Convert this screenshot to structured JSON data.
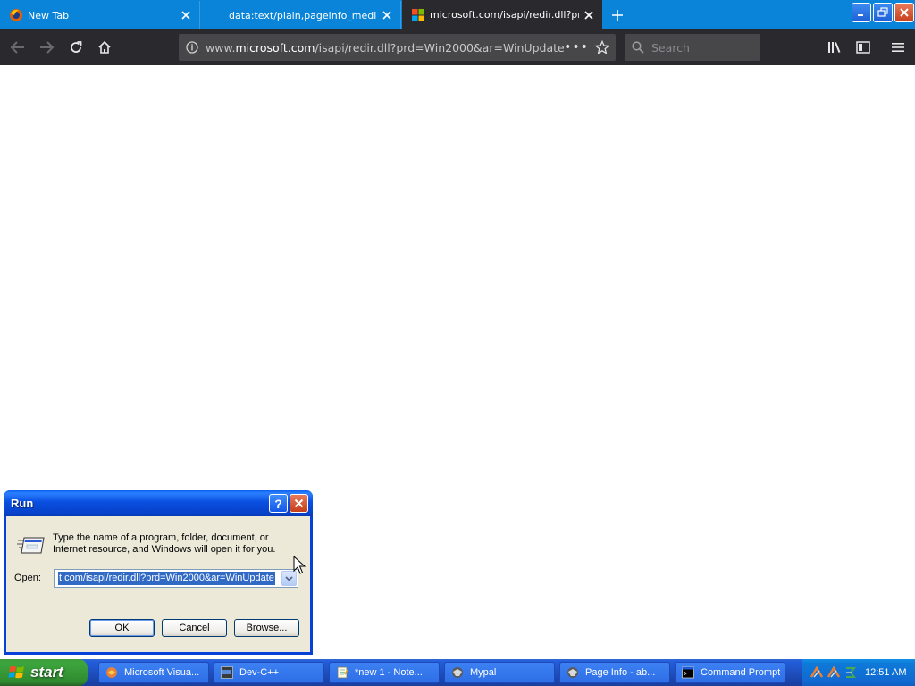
{
  "browser": {
    "tabs": [
      {
        "title": "New Tab",
        "favicon": "firefox-icon",
        "active": false
      },
      {
        "title": "data:text/plain,pageinfo_media",
        "favicon": "none",
        "active": false
      },
      {
        "title": "microsoft.com/isapi/redir.dll?prd=W",
        "favicon": "microsoft-logo-icon",
        "active": true
      }
    ],
    "url": {
      "prefix": "www.",
      "domain": "microsoft.com",
      "path": "/isapi/redir.dll?prd=Win2000&ar=WinUpdate"
    },
    "page_actions": "•••",
    "search_placeholder": "Search",
    "colors": {
      "tabstrip": "#0a84d8",
      "toolbar": "#2a2a2e",
      "field": "#474749"
    }
  },
  "run_dialog": {
    "title": "Run",
    "help_label": "?",
    "description": "Type the name of a program, folder, document, or Internet resource, and Windows will open it for you.",
    "open_label": "Open:",
    "open_value": "t.com/isapi/redir.dll?prd=Win2000&ar=WinUpdate",
    "ok_label": "OK",
    "cancel_label": "Cancel",
    "browse_label": "Browse..."
  },
  "taskbar": {
    "start_label": "start",
    "tasks": [
      {
        "label": "Microsoft Visua...",
        "icon": "visual-studio-icon"
      },
      {
        "label": "Dev-C++",
        "icon": "devcpp-icon"
      },
      {
        "label": "*new 1 - Note...",
        "icon": "notepad-icon"
      },
      {
        "label": "Mypal",
        "icon": "mypal-icon"
      },
      {
        "label": "Page Info - ab...",
        "icon": "firefox-icon"
      },
      {
        "label": "Command Prompt",
        "icon": "command-prompt-icon"
      }
    ],
    "clock": "12:51 AM"
  }
}
